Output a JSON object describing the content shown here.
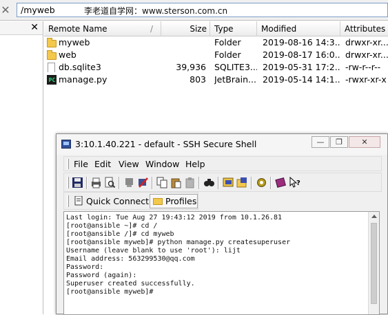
{
  "pathbar": {
    "path": "/myweb",
    "watermark": "李老道自学网：www.sterson.com.cn"
  },
  "file_table": {
    "columns": [
      "Remote Name",
      "Size",
      "Type",
      "Modified",
      "Attributes"
    ],
    "rows": [
      {
        "icon": "folder-icon",
        "name": "myweb",
        "size": "",
        "type": "Folder",
        "modified": "2019-08-16 14:3...",
        "attributes": "drwxr-xr..."
      },
      {
        "icon": "folder-icon",
        "name": "web",
        "size": "",
        "type": "Folder",
        "modified": "2019-08-17 16:0...",
        "attributes": "drwxr-xr..."
      },
      {
        "icon": "file-icon",
        "name": "db.sqlite3",
        "size": "39,936",
        "type": "SQLITE3...",
        "modified": "2019-05-31 17:2...",
        "attributes": "-rw-r--r--"
      },
      {
        "icon": "pycharm-file-icon",
        "name": "manage.py",
        "size": "803",
        "type": "JetBrain...",
        "modified": "2019-05-14 14:1...",
        "attributes": "-rwxr-xr-x"
      }
    ]
  },
  "ssh_window": {
    "title": "3:10.1.40.221 - default - SSH Secure Shell",
    "menu": [
      "File",
      "Edit",
      "View",
      "Window",
      "Help"
    ],
    "quick_connect": "Quick Connect",
    "profiles": "Profiles",
    "terminal_lines": [
      "Last login: Tue Aug 27 19:43:12 2019 from 10.1.26.81",
      "[root@ansible ~]# cd /",
      "[root@ansible /]# cd myweb",
      "[root@ansible myweb]# python manage.py createsuperuser",
      "Username (leave blank to use 'root'): lijt",
      "Email address: 563299530@qq.com",
      "Password:",
      "Password (again):",
      "Superuser created successfully.",
      "[root@ansible myweb]#"
    ]
  },
  "colors": {
    "folder": "#f3c84b",
    "pycharm_green": "#23e07a",
    "input_border": "#7a9cc6"
  }
}
